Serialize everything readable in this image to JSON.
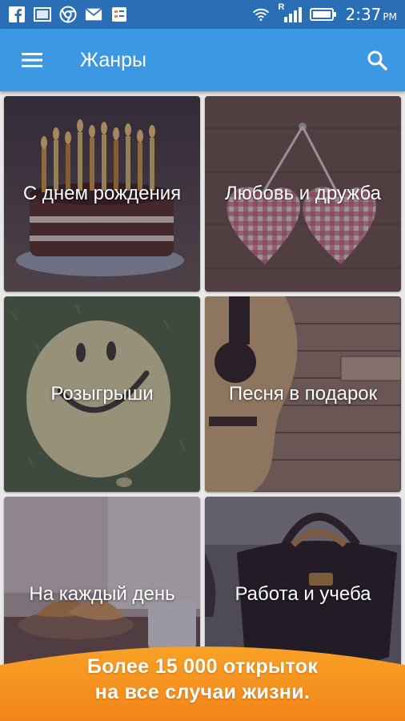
{
  "status_bar": {
    "time": "2:37",
    "ampm": "PM",
    "icons": [
      "facebook-icon",
      "gallery-icon",
      "chrome-icon",
      "mail-icon",
      "clipboard-icon",
      "wifi-icon",
      "signal-icon",
      "battery-icon"
    ],
    "roaming_letter": "R"
  },
  "app_bar": {
    "title": "Жанры",
    "menu_icon": "hamburger-icon",
    "search_icon": "search-icon"
  },
  "genres": [
    {
      "label": "С днем рождения",
      "theme": "birthday-cake"
    },
    {
      "label": "Любовь и дружба",
      "theme": "gingham-hearts"
    },
    {
      "label": "Розыгрыши",
      "theme": "smiley-balloon"
    },
    {
      "label": "Песня в подарок",
      "theme": "acoustic-guitar"
    },
    {
      "label": "На каждый день",
      "theme": "croissants-coffee"
    },
    {
      "label": "Работа и учеба",
      "theme": "leather-bag"
    }
  ],
  "promo_banner": {
    "line1": "Более 15 000 открыток",
    "line2": "на все случаи жизни."
  },
  "colors": {
    "status_bar": "#2a6fb6",
    "app_bar": "#3d98e3",
    "banner": "#f7941d"
  }
}
